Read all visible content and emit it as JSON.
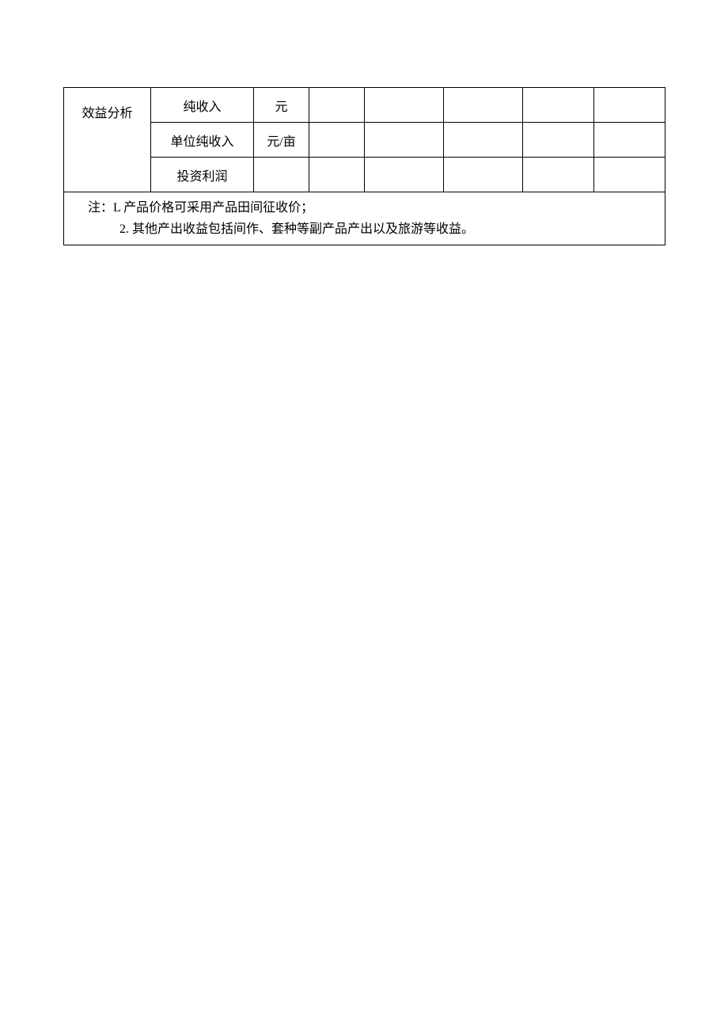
{
  "table": {
    "group_label": "效益分析",
    "rows": [
      {
        "label": "纯收入",
        "unit": "元",
        "cells": [
          "",
          "",
          "",
          "",
          ""
        ]
      },
      {
        "label": "单位纯收入",
        "unit": "元/亩",
        "cells": [
          "",
          "",
          "",
          "",
          ""
        ]
      },
      {
        "label": "投资利润",
        "unit": "",
        "cells": [
          "",
          "",
          "",
          "",
          ""
        ]
      }
    ],
    "note": {
      "line1": "注：L 产品价格可采用产品田间征收价；",
      "line2": "2. 其他产出收益包括间作、套种等副产品产出以及旅游等收益。"
    }
  }
}
